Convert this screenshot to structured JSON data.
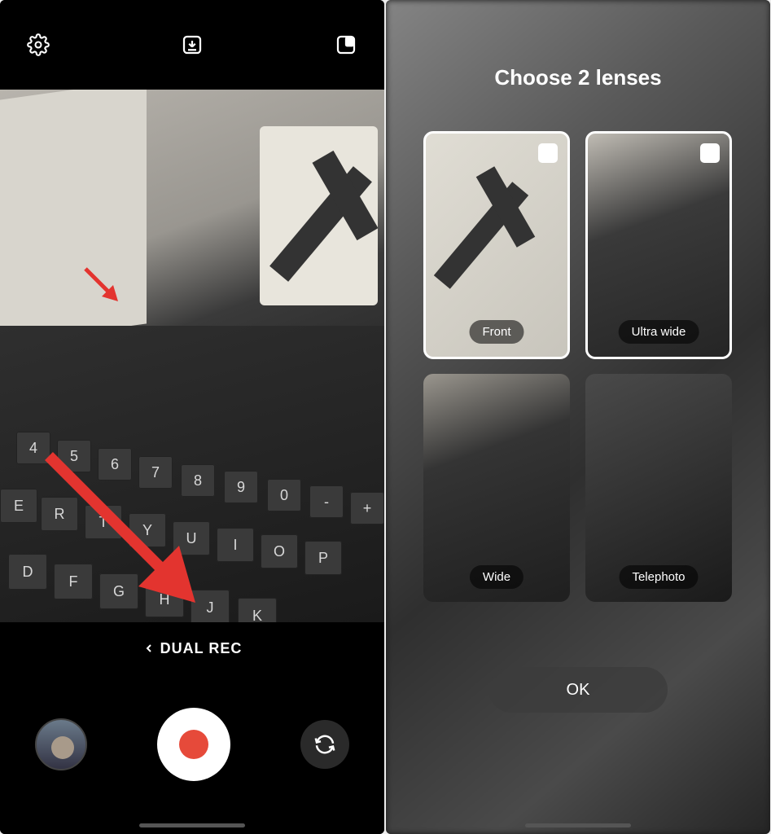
{
  "left": {
    "topbar": {
      "settings_icon": "settings",
      "download_icon": "download",
      "layout_icon": "pip-layout"
    },
    "mode_label": "DUAL REC",
    "gallery": "gallery-thumbnail",
    "shutter": "record-button",
    "switch": "switch-camera"
  },
  "right": {
    "title": "Choose 2 lenses",
    "lenses": [
      {
        "label": "Front",
        "selected": true
      },
      {
        "label": "Ultra wide",
        "selected": true
      },
      {
        "label": "Wide",
        "selected": false
      },
      {
        "label": "Telephoto",
        "selected": false
      }
    ],
    "ok_label": "OK"
  }
}
